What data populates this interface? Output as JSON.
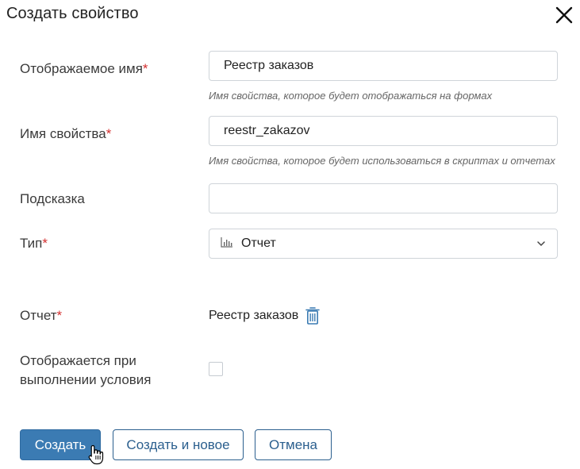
{
  "dialog": {
    "title": "Создать свойство"
  },
  "fields": {
    "display_name": {
      "label": "Отображаемое имя",
      "required_mark": "*",
      "value": "Реестр заказов",
      "hint": "Имя свойства, которое будет отображаться на формах"
    },
    "property_name": {
      "label": "Имя свойства",
      "required_mark": "*",
      "value": "reestr_zakazov",
      "hint": "Имя свойства, которое будет использоваться в скриптах и отчетах"
    },
    "tooltip": {
      "label": "Подсказка",
      "value": ""
    },
    "type": {
      "label": "Тип",
      "required_mark": "*",
      "selected": "Отчет",
      "icon": "bar-chart-icon"
    },
    "report": {
      "label": "Отчет",
      "required_mark": "*",
      "value": "Реестр заказов"
    },
    "conditional": {
      "label_line1": "Отображается при",
      "label_line2": "выполнении условия",
      "checked": false
    }
  },
  "buttons": {
    "create": "Создать",
    "create_and_new": "Создать и новое",
    "cancel": "Отмена"
  },
  "colors": {
    "primary": "#3b7bb3",
    "required": "#d32f2f",
    "outline": "#2b5f8e"
  }
}
